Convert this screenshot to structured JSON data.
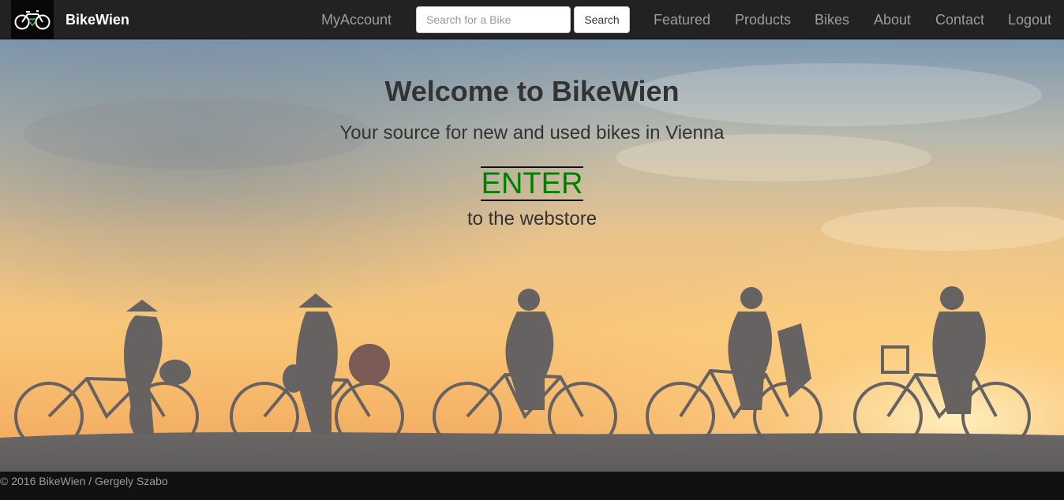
{
  "navbar": {
    "brand": "BikeWien",
    "logo_icon": "bicycle-heart-icon",
    "links": {
      "myaccount": "MyAccount",
      "featured": "Featured",
      "products": "Products",
      "bikes": "Bikes",
      "about": "About",
      "contact": "Contact",
      "logout": "Logout"
    },
    "search": {
      "placeholder": "Search for a Bike",
      "value": "",
      "button_label": "Search"
    }
  },
  "hero": {
    "title": "Welcome to BikeWien",
    "subtitle": "Your source for new and used bikes in Vienna",
    "enter_label": "ENTER",
    "enter_caption": "to the webstore",
    "enter_color": "#008000"
  },
  "footer": {
    "copyright": "© 2016 BikeWien / Gergely Szabo"
  },
  "colors": {
    "navbar_bg": "#222222",
    "nav_link": "#9d9d9d",
    "brand": "#ffffff",
    "footer_bg": "#111111"
  }
}
